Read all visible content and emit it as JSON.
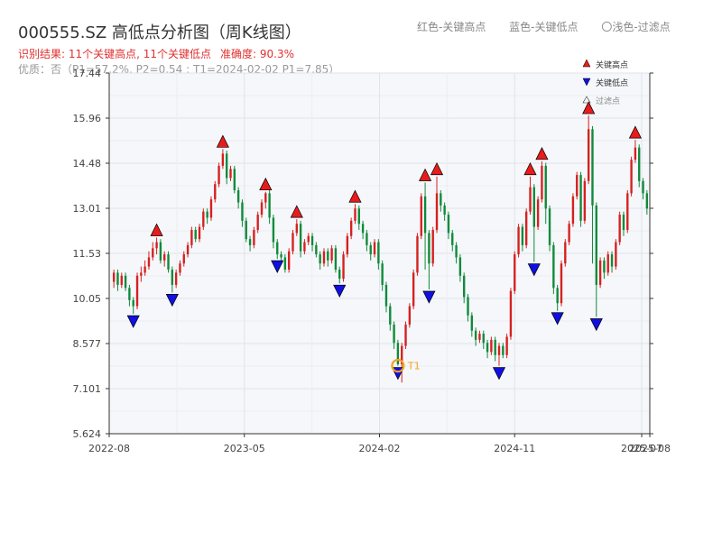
{
  "title": "000555.SZ 高低点分析图（周K线图）",
  "legend_top": {
    "high": "红色-关键高点",
    "low": "蓝色-关键低点",
    "filtered": "〇浅色-过滤点"
  },
  "result_line": {
    "text": "识别结果: 11个关键高点, 11个关键低点",
    "accuracy": "准确度: 90.3%"
  },
  "quality_line": "优质：否（P1=57.2%, P2=0.54 ; T1=2024-02-02 P1=7.85）",
  "colors": {
    "up": "#d62020",
    "down": "#0f8a3a",
    "high_marker": "#e81c1c",
    "low_marker": "#1010e0",
    "t1": "#f5a020",
    "plot_bg": "#f5f7fa",
    "grid": "#e0e3e8"
  },
  "chart_data": {
    "type": "candlestick",
    "title": "000555.SZ 高低点分析图（周K线图）",
    "y_ticks": [
      "5.624",
      "7.101",
      "8.577",
      "10.05",
      "11.53",
      "13.01",
      "14.48",
      "15.96",
      "17.44"
    ],
    "ylim": [
      5.624,
      17.44
    ],
    "x_ticks": [
      "2022-08",
      "2023-05",
      "2024-02",
      "2024-11",
      "2025-07",
      "2025-08"
    ],
    "grid": true,
    "legend": {
      "placement": "top-right",
      "entries": [
        {
          "label": "关键高点",
          "marker": "triangle-up",
          "color": "#e81c1c"
        },
        {
          "label": "关键低点",
          "marker": "triangle-down",
          "color": "#1010e0"
        },
        {
          "label": "过滤点",
          "marker": "triangle-up-outline",
          "color": "#aaaaaa"
        }
      ]
    },
    "key_highs": [
      12.05,
      14.95,
      13.55,
      12.65,
      13.15,
      13.85,
      14.05,
      14.05,
      14.55,
      16.05,
      15.25
    ],
    "key_lows": [
      9.55,
      10.25,
      11.35,
      10.75,
      10.55,
      10.35,
      7.85,
      7.85,
      11.25,
      9.65,
      9.45
    ],
    "annotation": {
      "label": "T1",
      "value": 7.85,
      "date": "2024-02-02"
    },
    "candles": [
      [
        10.6,
        10.9,
        10.4,
        11.0
      ],
      [
        10.9,
        10.5,
        10.3,
        11.0
      ],
      [
        10.5,
        10.8,
        10.4,
        10.9
      ],
      [
        10.8,
        10.4,
        10.3,
        10.9
      ],
      [
        10.4,
        10.0,
        9.8,
        10.5
      ],
      [
        10.0,
        9.8,
        9.55,
        10.1
      ],
      [
        9.8,
        10.8,
        9.7,
        10.9
      ],
      [
        10.8,
        10.9,
        10.6,
        11.1
      ],
      [
        10.9,
        11.1,
        10.8,
        11.3
      ],
      [
        11.1,
        11.4,
        11.0,
        11.6
      ],
      [
        11.4,
        11.7,
        11.3,
        11.9
      ],
      [
        11.7,
        11.9,
        11.5,
        12.05
      ],
      [
        11.9,
        11.3,
        11.2,
        12.0
      ],
      [
        11.3,
        11.5,
        11.1,
        11.6
      ],
      [
        11.5,
        11.0,
        10.9,
        11.6
      ],
      [
        11.0,
        10.5,
        10.25,
        11.1
      ],
      [
        10.5,
        10.9,
        10.4,
        11.0
      ],
      [
        10.9,
        11.2,
        10.8,
        11.3
      ],
      [
        11.2,
        11.5,
        11.1,
        11.6
      ],
      [
        11.5,
        11.8,
        11.4,
        11.9
      ],
      [
        11.8,
        12.3,
        11.7,
        12.4
      ],
      [
        12.3,
        12.0,
        11.9,
        12.4
      ],
      [
        12.0,
        12.4,
        11.9,
        12.5
      ],
      [
        12.4,
        12.9,
        12.3,
        13.0
      ],
      [
        12.9,
        12.7,
        12.5,
        13.0
      ],
      [
        12.7,
        13.3,
        12.6,
        13.4
      ],
      [
        13.3,
        13.8,
        13.2,
        13.9
      ],
      [
        13.8,
        14.4,
        13.7,
        14.5
      ],
      [
        14.4,
        14.8,
        14.3,
        14.95
      ],
      [
        14.8,
        14.0,
        13.8,
        14.9
      ],
      [
        14.0,
        14.3,
        13.9,
        14.4
      ],
      [
        14.3,
        13.6,
        13.5,
        14.4
      ],
      [
        13.6,
        13.2,
        13.0,
        13.7
      ],
      [
        13.2,
        12.6,
        12.4,
        13.3
      ],
      [
        12.6,
        12.0,
        11.9,
        12.7
      ],
      [
        12.0,
        11.8,
        11.6,
        12.1
      ],
      [
        11.8,
        12.3,
        11.7,
        12.4
      ],
      [
        12.3,
        12.8,
        12.2,
        12.9
      ],
      [
        12.8,
        13.2,
        12.7,
        13.3
      ],
      [
        13.2,
        13.5,
        13.0,
        13.55
      ],
      [
        13.5,
        12.7,
        12.5,
        13.6
      ],
      [
        12.7,
        11.9,
        11.7,
        12.8
      ],
      [
        11.9,
        11.5,
        11.35,
        12.0
      ],
      [
        11.5,
        11.4,
        11.2,
        11.6
      ],
      [
        11.4,
        11.0,
        10.9,
        11.5
      ],
      [
        11.0,
        11.6,
        10.9,
        11.7
      ],
      [
        11.6,
        12.2,
        11.5,
        12.3
      ],
      [
        12.2,
        12.5,
        12.1,
        12.65
      ],
      [
        12.5,
        11.6,
        11.4,
        12.6
      ],
      [
        11.6,
        11.9,
        11.5,
        12.0
      ],
      [
        11.9,
        12.1,
        11.8,
        12.2
      ],
      [
        12.1,
        11.8,
        11.6,
        12.2
      ],
      [
        11.8,
        11.5,
        11.4,
        11.9
      ],
      [
        11.5,
        11.2,
        11.0,
        11.6
      ],
      [
        11.2,
        11.6,
        11.1,
        11.7
      ],
      [
        11.6,
        11.3,
        11.1,
        11.7
      ],
      [
        11.3,
        11.7,
        11.2,
        11.8
      ],
      [
        11.7,
        11.0,
        10.9,
        11.8
      ],
      [
        11.0,
        10.7,
        10.55,
        11.1
      ],
      [
        10.7,
        11.5,
        10.6,
        11.6
      ],
      [
        11.5,
        12.1,
        11.4,
        12.2
      ],
      [
        12.1,
        12.6,
        12.0,
        12.7
      ],
      [
        12.6,
        13.0,
        12.5,
        13.15
      ],
      [
        13.0,
        12.5,
        12.3,
        13.1
      ],
      [
        12.5,
        12.2,
        12.0,
        12.6
      ],
      [
        12.2,
        11.8,
        11.6,
        12.3
      ],
      [
        11.8,
        11.5,
        11.3,
        11.9
      ],
      [
        11.5,
        11.9,
        11.4,
        12.0
      ],
      [
        11.9,
        11.2,
        11.0,
        12.0
      ],
      [
        11.2,
        10.5,
        10.3,
        11.3
      ],
      [
        10.5,
        9.8,
        9.6,
        10.6
      ],
      [
        9.8,
        9.2,
        9.0,
        9.9
      ],
      [
        9.2,
        8.6,
        8.4,
        9.3
      ],
      [
        8.6,
        7.9,
        7.85,
        8.7
      ],
      [
        7.9,
        8.5,
        7.3,
        8.6
      ],
      [
        8.5,
        9.2,
        8.4,
        9.3
      ],
      [
        9.2,
        9.8,
        9.1,
        9.9
      ],
      [
        9.8,
        10.9,
        9.7,
        11.0
      ],
      [
        10.9,
        12.1,
        10.8,
        12.2
      ],
      [
        12.1,
        13.4,
        12.0,
        13.5
      ],
      [
        13.4,
        12.2,
        11.0,
        13.85
      ],
      [
        12.2,
        11.2,
        10.35,
        12.3
      ],
      [
        11.2,
        12.3,
        11.1,
        12.4
      ],
      [
        12.3,
        13.5,
        12.2,
        14.05
      ],
      [
        13.5,
        13.1,
        12.9,
        13.6
      ],
      [
        13.1,
        12.8,
        12.6,
        13.2
      ],
      [
        12.8,
        12.2,
        12.0,
        12.9
      ],
      [
        12.2,
        11.8,
        11.6,
        12.3
      ],
      [
        11.8,
        11.4,
        11.2,
        11.9
      ],
      [
        11.4,
        10.8,
        10.6,
        11.5
      ],
      [
        10.8,
        10.1,
        9.9,
        10.9
      ],
      [
        10.1,
        9.5,
        9.3,
        10.2
      ],
      [
        9.5,
        9.0,
        8.8,
        9.6
      ],
      [
        9.0,
        8.7,
        8.5,
        9.1
      ],
      [
        8.7,
        8.9,
        8.6,
        9.0
      ],
      [
        8.9,
        8.6,
        8.4,
        9.0
      ],
      [
        8.6,
        8.3,
        8.1,
        8.7
      ],
      [
        8.3,
        8.7,
        8.2,
        8.8
      ],
      [
        8.7,
        8.2,
        8.0,
        8.8
      ],
      [
        8.2,
        8.5,
        7.85,
        8.6
      ],
      [
        8.5,
        8.2,
        8.1,
        8.6
      ],
      [
        8.2,
        8.8,
        8.1,
        8.9
      ],
      [
        8.8,
        10.3,
        8.7,
        10.4
      ],
      [
        10.3,
        11.5,
        10.2,
        11.6
      ],
      [
        11.5,
        12.4,
        11.4,
        12.5
      ],
      [
        12.4,
        11.8,
        11.6,
        12.5
      ],
      [
        11.8,
        12.9,
        11.7,
        13.0
      ],
      [
        12.9,
        13.7,
        12.8,
        14.05
      ],
      [
        13.7,
        12.4,
        11.25,
        13.8
      ],
      [
        12.4,
        13.3,
        12.3,
        13.4
      ],
      [
        13.3,
        14.4,
        13.2,
        14.55
      ],
      [
        14.4,
        13.0,
        12.5,
        14.5
      ],
      [
        13.0,
        11.8,
        11.6,
        13.1
      ],
      [
        11.8,
        10.4,
        10.2,
        11.9
      ],
      [
        10.4,
        9.9,
        9.65,
        10.5
      ],
      [
        9.9,
        11.2,
        9.8,
        11.3
      ],
      [
        11.2,
        11.9,
        11.1,
        12.0
      ],
      [
        11.9,
        12.5,
        11.8,
        12.6
      ],
      [
        12.5,
        13.4,
        12.4,
        13.5
      ],
      [
        13.4,
        14.1,
        13.3,
        14.2
      ],
      [
        14.1,
        12.6,
        12.4,
        14.2
      ],
      [
        12.6,
        13.9,
        12.5,
        14.0
      ],
      [
        13.9,
        15.6,
        13.8,
        16.05
      ],
      [
        15.6,
        13.1,
        11.2,
        15.7
      ],
      [
        13.1,
        10.5,
        9.45,
        13.2
      ],
      [
        10.5,
        11.3,
        10.4,
        11.4
      ],
      [
        11.3,
        10.9,
        10.7,
        11.4
      ],
      [
        10.9,
        11.5,
        10.8,
        11.6
      ],
      [
        11.5,
        11.1,
        10.9,
        11.6
      ],
      [
        11.1,
        11.9,
        11.0,
        12.0
      ],
      [
        11.9,
        12.8,
        11.8,
        12.9
      ],
      [
        12.8,
        12.3,
        12.1,
        12.9
      ],
      [
        12.3,
        13.5,
        12.2,
        13.6
      ],
      [
        13.5,
        14.6,
        13.4,
        14.7
      ],
      [
        14.6,
        15.0,
        14.5,
        15.25
      ],
      [
        15.0,
        13.9,
        13.7,
        15.1
      ],
      [
        13.9,
        13.5,
        13.3,
        14.0
      ],
      [
        13.5,
        13.0,
        12.8,
        13.6
      ]
    ]
  }
}
